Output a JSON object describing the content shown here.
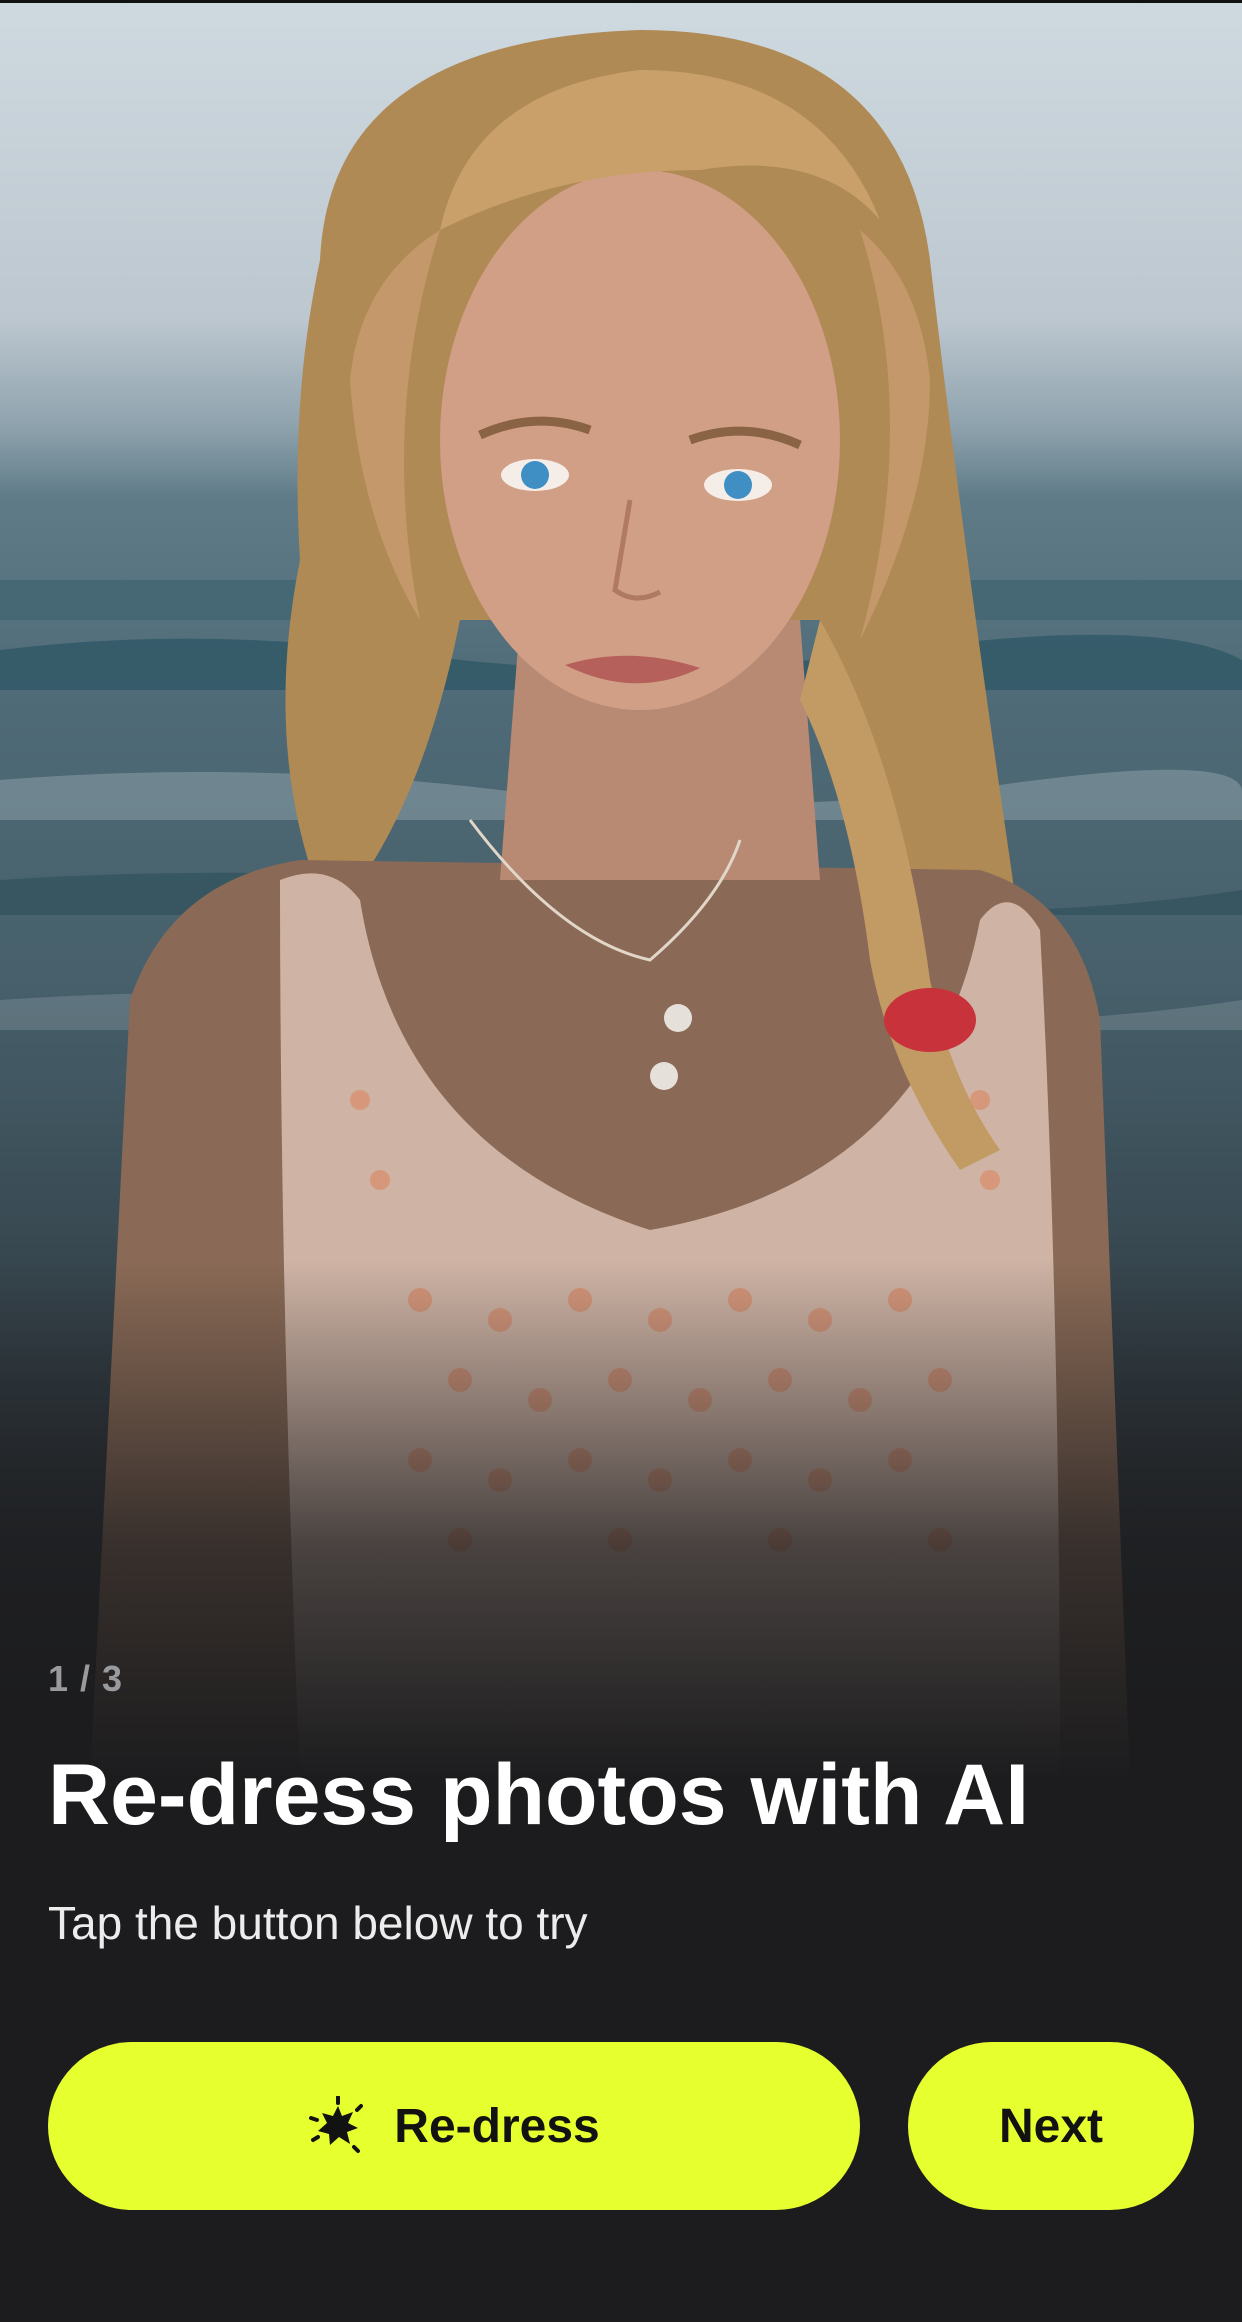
{
  "onboarding": {
    "pager": "1 / 3",
    "title": "Re-dress photos with AI",
    "subtitle": "Tap the button below to try"
  },
  "actions": {
    "redress_label": "Re-dress",
    "redress_icon": "sparkle-splash-icon",
    "next_label": "Next"
  },
  "colors": {
    "background": "#1c1c1e",
    "accent": "#e6ff2e",
    "button_text": "#121212",
    "title_text": "#ffffff",
    "pager_text": "#9a9a9e"
  }
}
